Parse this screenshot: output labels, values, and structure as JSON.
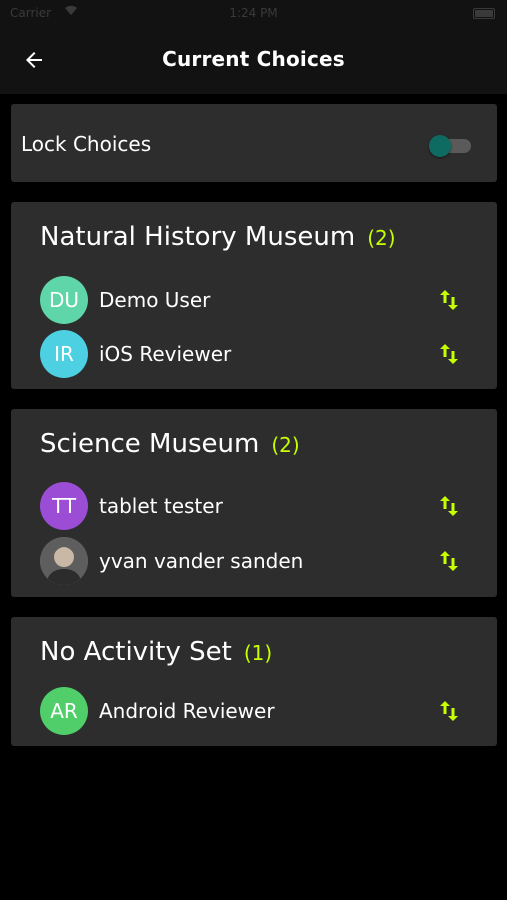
{
  "status_bar": {
    "carrier": "Carrier",
    "time": "1:24 PM"
  },
  "app_bar": {
    "title": "Current Choices",
    "back_icon": "arrow-back-icon"
  },
  "lock": {
    "label": "Lock Choices",
    "enabled": false
  },
  "colors": {
    "background": "#000000",
    "card": "#2d2d2d",
    "accent_count": "#c6ff00",
    "swap_icon": "#c6ff00",
    "toggle_thumb": "#0e6b61"
  },
  "groups": [
    {
      "title": "Natural History Museum",
      "count": "(2)",
      "members": [
        {
          "initials": "DU",
          "name": "Demo User",
          "avatar_color": "#5ed6a9"
        },
        {
          "initials": "IR",
          "name": "iOS Reviewer",
          "avatar_color": "#4dd0e1"
        }
      ]
    },
    {
      "title": "Science Museum",
      "count": "(2)",
      "members": [
        {
          "initials": "TT",
          "name": "tablet tester",
          "avatar_color": "#9c4dd6"
        },
        {
          "initials": "",
          "name": "yvan vander sanden",
          "avatar_color": "#6b6b6b",
          "avatar_type": "photo"
        }
      ]
    },
    {
      "title": "No Activity Set",
      "count": "(1)",
      "members": [
        {
          "initials": "AR",
          "name": "Android Reviewer",
          "avatar_color": "#4fce6a"
        }
      ]
    }
  ],
  "swap_icon": "swap-vert-icon"
}
